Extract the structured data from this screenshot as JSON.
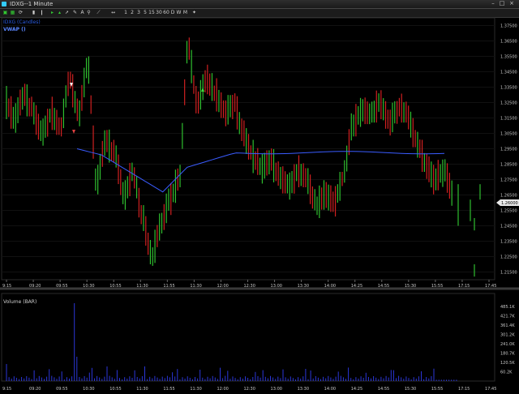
{
  "window": {
    "title": "IDXG--1 Minute"
  },
  "toolbar": {
    "interval_buttons": [
      "1",
      "2",
      "3",
      "5",
      "15",
      "30",
      "60",
      "D",
      "W",
      "M"
    ]
  },
  "chart_data": [
    {
      "type": "candlestick",
      "title": "IDXG--1 Minute",
      "series": [
        {
          "name": "IDXG (Candles)",
          "type": "candlestick"
        },
        {
          "name": "VWAP ()",
          "type": "line",
          "color": "#3a5cff"
        }
      ],
      "y_ticks": [
        "1.37500",
        "1.36500",
        "1.35500",
        "1.34500",
        "1.33500",
        "1.32500",
        "1.31500",
        "1.30500",
        "1.29500",
        "1.28500",
        "1.27500",
        "1.26500",
        "1.25500",
        "1.24500",
        "1.23500",
        "1.22500",
        "1.21500"
      ],
      "x_ticks": [
        "9:15",
        "09:20",
        "09:55",
        "10:30",
        "10:55",
        "11:30",
        "11:55",
        "11:30",
        "12:00",
        "12:30",
        "13:00",
        "13:30",
        "14:00",
        "14:25",
        "14:55",
        "15:30",
        "15:55",
        "17:15",
        "17:45"
      ],
      "last_price": "1.26000",
      "ylim": [
        1.21,
        1.38
      ],
      "candles": [
        [
          1.325,
          1.345,
          1.308,
          1.315
        ],
        [
          1.315,
          1.335,
          1.3,
          1.33
        ],
        [
          1.33,
          1.341,
          1.316,
          1.318
        ],
        [
          1.318,
          1.33,
          1.3,
          1.305
        ],
        [
          1.305,
          1.321,
          1.297,
          1.318
        ],
        [
          1.318,
          1.333,
          1.304,
          1.307
        ],
        [
          1.307,
          1.345,
          1.303,
          1.34
        ],
        [
          1.34,
          1.345,
          1.313,
          1.318
        ],
        [
          1.318,
          1.354,
          1.309,
          1.348
        ],
        [
          1.348,
          1.355,
          1.265,
          1.275
        ],
        [
          1.275,
          1.307,
          1.255,
          1.3
        ],
        [
          1.3,
          1.318,
          1.286,
          1.29
        ],
        [
          1.29,
          1.305,
          1.259,
          1.265
        ],
        [
          1.265,
          1.286,
          1.244,
          1.28
        ],
        [
          1.28,
          1.283,
          1.246,
          1.25
        ],
        [
          1.25,
          1.262,
          1.22,
          1.225
        ],
        [
          1.225,
          1.253,
          1.213,
          1.245
        ],
        [
          1.245,
          1.27,
          1.24,
          1.262
        ],
        [
          1.262,
          1.283,
          1.252,
          1.275
        ],
        [
          1.275,
          1.365,
          1.27,
          1.36
        ],
        [
          1.36,
          1.368,
          1.318,
          1.325
        ],
        [
          1.325,
          1.346,
          1.312,
          1.34
        ],
        [
          1.34,
          1.356,
          1.326,
          1.33
        ],
        [
          1.33,
          1.343,
          1.315,
          1.318
        ],
        [
          1.318,
          1.33,
          1.305,
          1.325
        ],
        [
          1.325,
          1.335,
          1.3,
          1.305
        ],
        [
          1.305,
          1.315,
          1.288,
          1.29
        ],
        [
          1.29,
          1.305,
          1.278,
          1.282
        ],
        [
          1.282,
          1.294,
          1.27,
          1.288
        ],
        [
          1.288,
          1.297,
          1.271,
          1.276
        ],
        [
          1.276,
          1.29,
          1.266,
          1.27
        ],
        [
          1.27,
          1.285,
          1.262,
          1.28
        ],
        [
          1.28,
          1.292,
          1.27,
          1.274
        ],
        [
          1.274,
          1.286,
          1.255,
          1.258
        ],
        [
          1.258,
          1.275,
          1.25,
          1.265
        ],
        [
          1.265,
          1.282,
          1.254,
          1.26
        ],
        [
          1.26,
          1.28,
          1.251,
          1.278
        ],
        [
          1.278,
          1.318,
          1.273,
          1.31
        ],
        [
          1.31,
          1.328,
          1.303,
          1.32
        ],
        [
          1.32,
          1.33,
          1.311,
          1.316
        ],
        [
          1.316,
          1.344,
          1.312,
          1.325
        ],
        [
          1.325,
          1.333,
          1.308,
          1.312
        ],
        [
          1.312,
          1.326,
          1.303,
          1.322
        ],
        [
          1.322,
          1.335,
          1.312,
          1.316
        ],
        [
          1.316,
          1.323,
          1.296,
          1.3
        ],
        [
          1.3,
          1.306,
          1.28,
          1.285
        ],
        [
          1.285,
          1.292,
          1.262,
          1.275
        ],
        [
          1.275,
          1.288,
          1.268,
          1.281
        ],
        [
          1.281,
          1.292,
          1.258,
          1.266
        ]
      ],
      "volume": {
        "title": "Volume (BAR)",
        "y_ticks": [
          "485.1K",
          "421.7K",
          "361.4K",
          "301.2K",
          "241.0K",
          "180.7K",
          "120.5K",
          "60.2K"
        ],
        "ylim": [
          0,
          500
        ],
        "peak": 480
      }
    }
  ]
}
